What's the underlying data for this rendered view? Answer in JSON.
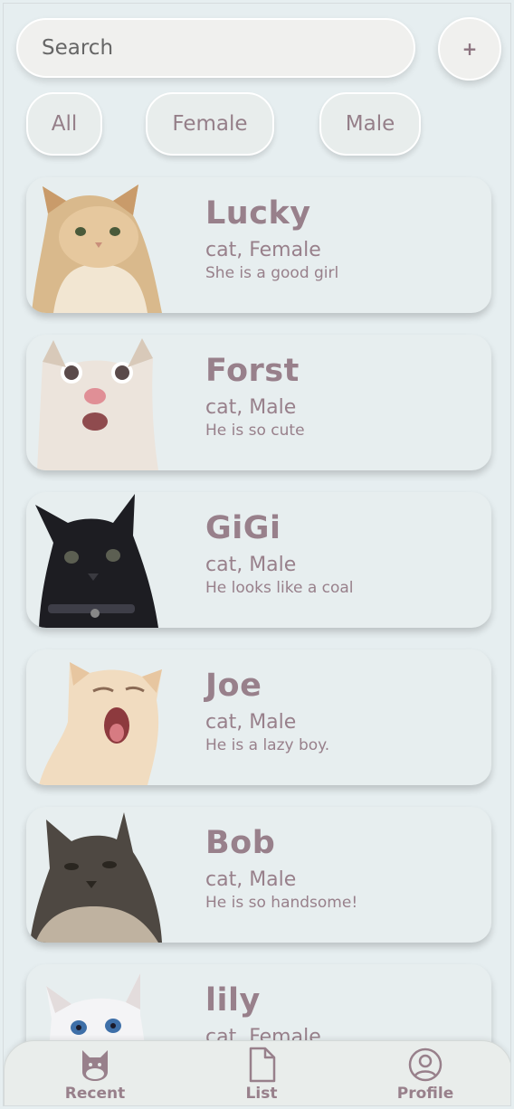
{
  "search": {
    "placeholder": "Search"
  },
  "add_button": {
    "label": "+"
  },
  "filters": [
    "All",
    "Female",
    "Male"
  ],
  "pets": [
    {
      "name": "Lucky",
      "subtitle": "cat, Female",
      "description": "She is a good girl",
      "photo": "fluffy-orange-cat"
    },
    {
      "name": "Forst",
      "subtitle": "cat, Male",
      "description": "He is so cute",
      "photo": "surprised-white-cat"
    },
    {
      "name": "GiGi",
      "subtitle": "cat, Male",
      "description": "He looks like a coal",
      "photo": "black-cat"
    },
    {
      "name": "Joe",
      "subtitle": "cat, Male",
      "description": "He is a lazy boy.",
      "photo": "yawning-cream-cat"
    },
    {
      "name": "Bob",
      "subtitle": "cat, Male",
      "description": "He is so handsome!",
      "photo": "dark-maine-coon-cat"
    },
    {
      "name": "lily",
      "subtitle": "cat, Female",
      "description": "",
      "photo": "white-blue-eyed-cat"
    }
  ],
  "tabbar": {
    "items": [
      {
        "label": "Recent",
        "icon": "cat-icon"
      },
      {
        "label": "List",
        "icon": "document-icon"
      },
      {
        "label": "Profile",
        "icon": "user-circle-icon"
      }
    ]
  },
  "colors": {
    "accent": "#98808b",
    "background": "#e6eef0",
    "card": "#e7eeef"
  }
}
